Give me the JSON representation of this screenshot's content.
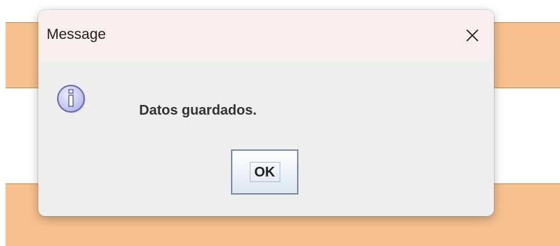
{
  "dialog": {
    "title": "Message",
    "message": "Datos guardados.",
    "ok_label": "OK",
    "close_icon": "close-icon",
    "message_icon": "info-icon"
  },
  "colors": {
    "background_band": "#f7c08e",
    "dialog_body": "#eeeeee",
    "titlebar": "#f8eeee",
    "info_icon_fill": "#c8c8f5",
    "info_icon_stroke": "#6a6aaa"
  }
}
